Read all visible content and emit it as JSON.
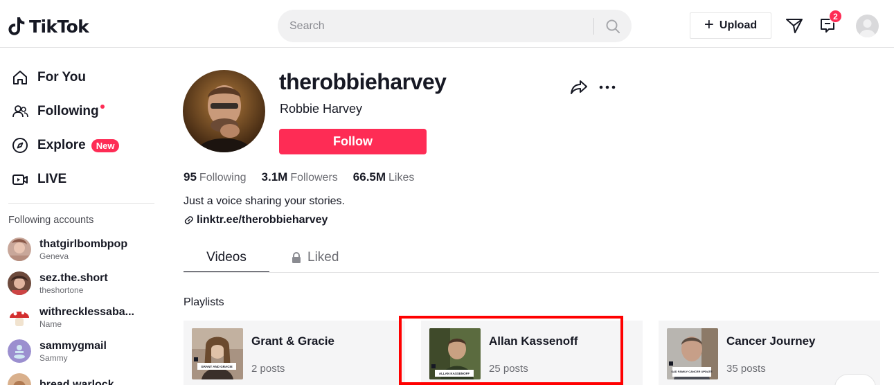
{
  "header": {
    "logo_text": "TikTok",
    "search_placeholder": "Search",
    "upload_label": "Upload",
    "inbox_badge": "2"
  },
  "sidebar": {
    "nav": [
      {
        "label": "For You",
        "icon": "home-icon"
      },
      {
        "label": "Following",
        "icon": "users-icon"
      },
      {
        "label": "Explore",
        "icon": "compass-icon",
        "badge": "New"
      },
      {
        "label": "LIVE",
        "icon": "live-icon"
      }
    ],
    "accounts_heading": "Following accounts",
    "accounts": [
      {
        "name": "thatgirlbombpop",
        "sub": "Geneva"
      },
      {
        "name": "sez.the.short",
        "sub": "theshortone"
      },
      {
        "name": "withrecklessaba...",
        "sub": "Name"
      },
      {
        "name": "sammygmail",
        "sub": "Sammy"
      },
      {
        "name": "bread.warlock",
        "sub": ""
      }
    ]
  },
  "profile": {
    "username": "therobbieharvey",
    "nickname": "Robbie Harvey",
    "follow_label": "Follow",
    "stats": {
      "following_num": "95",
      "following_label": "Following",
      "followers_num": "3.1M",
      "followers_label": "Followers",
      "likes_num": "66.5M",
      "likes_label": "Likes"
    },
    "bio": "Just a voice sharing your stories.",
    "link": "linktr.ee/therobbieharvey"
  },
  "tabs": {
    "videos": "Videos",
    "liked": "Liked"
  },
  "playlists": {
    "heading": "Playlists",
    "items": [
      {
        "title": "Grant & Gracie",
        "count": "2 posts",
        "thumb_caption": "GRANT AND GRACIE"
      },
      {
        "title": "Allan Kassenoff",
        "count": "25 posts",
        "thumb_caption": "ALLAN KASSENOFF"
      },
      {
        "title": "Cancer Journey",
        "count": "35 posts",
        "thumb_caption": "SAD FAMILY CANCER UPDATE"
      }
    ]
  },
  "colors": {
    "brand": "#fe2c55",
    "highlight": "#ff0000"
  }
}
